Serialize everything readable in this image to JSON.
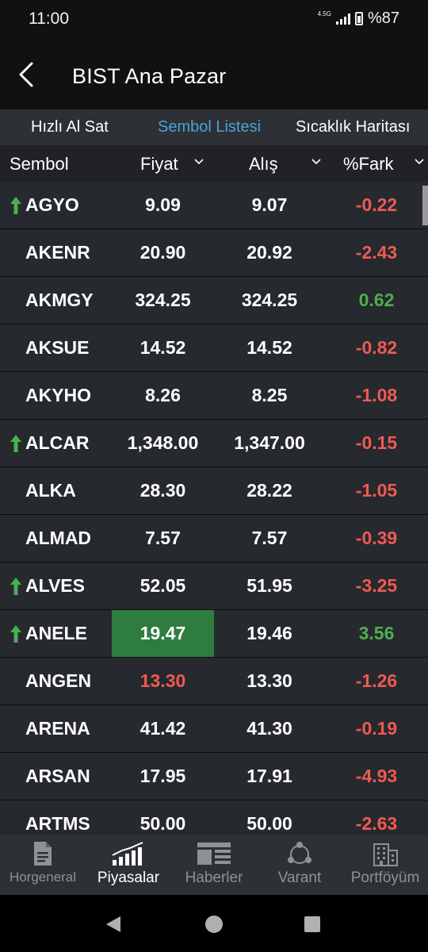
{
  "status": {
    "time": "11:00",
    "network": "4.5G",
    "battery": "%87"
  },
  "header": {
    "title": "BIST Ana Pazar",
    "back_icon": "chevron-left-icon"
  },
  "tabs": [
    {
      "label": "Hızlı Al Sat",
      "active": false
    },
    {
      "label": "Sembol Listesi",
      "active": true
    },
    {
      "label": "Sıcaklık Haritası",
      "active": false
    }
  ],
  "columns": {
    "symbol": "Sembol",
    "price": "Fiyat",
    "bid": "Alış",
    "diff": "%Fark"
  },
  "colors": {
    "accent": "#4aa3d8",
    "up": "#4caf50",
    "down": "#ee5a52",
    "highlight": "#2e7d3f"
  },
  "rows": [
    {
      "symbol": "AGYO",
      "arrow": "up",
      "price": "9.09",
      "bid": "9.07",
      "diff": "-0.22",
      "diff_dir": "down",
      "price_style": ""
    },
    {
      "symbol": "AKENR",
      "arrow": "",
      "price": "20.90",
      "bid": "20.92",
      "diff": "-2.43",
      "diff_dir": "down",
      "price_style": ""
    },
    {
      "symbol": "AKMGY",
      "arrow": "",
      "price": "324.25",
      "bid": "324.25",
      "diff": "0.62",
      "diff_dir": "up",
      "price_style": ""
    },
    {
      "symbol": "AKSUE",
      "arrow": "",
      "price": "14.52",
      "bid": "14.52",
      "diff": "-0.82",
      "diff_dir": "down",
      "price_style": ""
    },
    {
      "symbol": "AKYHO",
      "arrow": "",
      "price": "8.26",
      "bid": "8.25",
      "diff": "-1.08",
      "diff_dir": "down",
      "price_style": ""
    },
    {
      "symbol": "ALCAR",
      "arrow": "up",
      "price": "1,348.00",
      "bid": "1,347.00",
      "diff": "-0.15",
      "diff_dir": "down",
      "price_style": ""
    },
    {
      "symbol": "ALKA",
      "arrow": "",
      "price": "28.30",
      "bid": "28.22",
      "diff": "-1.05",
      "diff_dir": "down",
      "price_style": ""
    },
    {
      "symbol": "ALMAD",
      "arrow": "",
      "price": "7.57",
      "bid": "7.57",
      "diff": "-0.39",
      "diff_dir": "down",
      "price_style": ""
    },
    {
      "symbol": "ALVES",
      "arrow": "up",
      "price": "52.05",
      "bid": "51.95",
      "diff": "-3.25",
      "diff_dir": "down",
      "price_style": ""
    },
    {
      "symbol": "ANELE",
      "arrow": "up",
      "price": "19.47",
      "bid": "19.46",
      "diff": "3.56",
      "diff_dir": "up",
      "price_style": "highlight-green"
    },
    {
      "symbol": "ANGEN",
      "arrow": "",
      "price": "13.30",
      "bid": "13.30",
      "diff": "-1.26",
      "diff_dir": "down",
      "price_style": "text-red"
    },
    {
      "symbol": "ARENA",
      "arrow": "",
      "price": "41.42",
      "bid": "41.30",
      "diff": "-0.19",
      "diff_dir": "down",
      "price_style": ""
    },
    {
      "symbol": "ARSAN",
      "arrow": "",
      "price": "17.95",
      "bid": "17.91",
      "diff": "-4.93",
      "diff_dir": "down",
      "price_style": ""
    },
    {
      "symbol": "ARTMS",
      "arrow": "",
      "price": "50.00",
      "bid": "50.00",
      "diff": "-2.63",
      "diff_dir": "down",
      "price_style": ""
    }
  ],
  "bottom_nav": [
    {
      "label": "Horgeneral",
      "icon": "document-icon",
      "active": false
    },
    {
      "label": "Piyasalar",
      "icon": "bar-chart-icon",
      "active": true
    },
    {
      "label": "Haberler",
      "icon": "news-icon",
      "active": false
    },
    {
      "label": "Varant",
      "icon": "cycle-icon",
      "active": false
    },
    {
      "label": "Portföyüm",
      "icon": "building-icon",
      "active": false
    }
  ]
}
